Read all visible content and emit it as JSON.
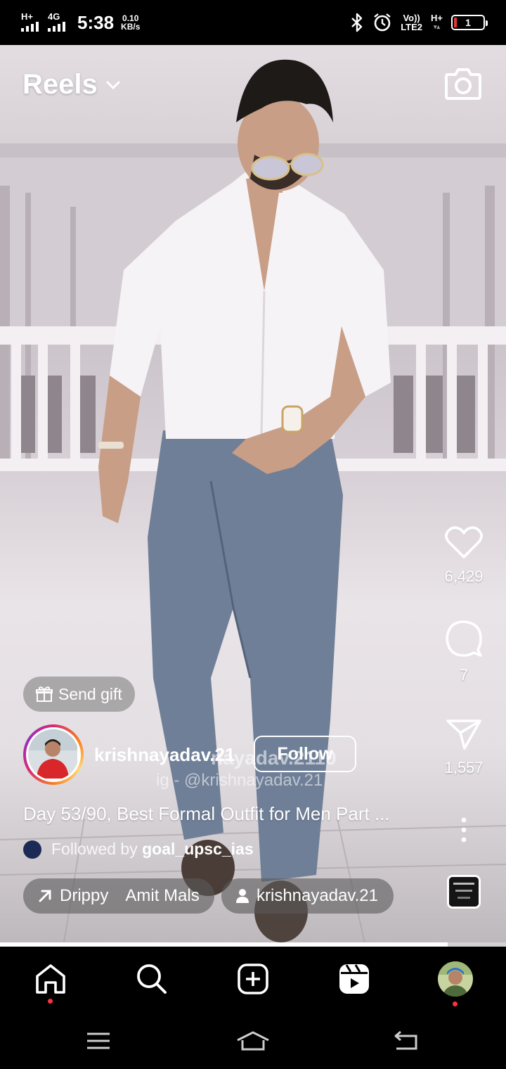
{
  "status_bar": {
    "sim1_tag": "H+",
    "sim2_tag": "4G",
    "time": "5:38",
    "net_speed_value": "0.10",
    "net_speed_unit": "KB/s",
    "volte_top": "Vo))",
    "volte_bottom": "LTE2",
    "sim2_right_tag": "H+",
    "battery_level": "1"
  },
  "header": {
    "title": "Reels",
    "camera_icon": "camera-icon",
    "dropdown_icon": "chevron-down-icon"
  },
  "actions": {
    "likes": "6,429",
    "comments": "7",
    "shares": "1,557"
  },
  "reel": {
    "send_gift_label": "Send gift",
    "username": "krishnayadav.21",
    "follow_label": "Follow",
    "watermark_line1": "nayadav.2110",
    "watermark_line2": "ig - @krishnayadav.21",
    "caption": "Day 53/90, Best Formal Outfit for Men Part ...",
    "followed_by_prefix": "Followed by",
    "followed_by_user": "goal_upsc_ias",
    "audio_label": "Drippy",
    "audio_artist": "Amit Mals",
    "tagged_user": "krishnayadav.21",
    "progress_fraction": 0.885
  },
  "bottom_nav": {
    "items": [
      "home-icon",
      "search-icon",
      "create-icon",
      "reels-icon",
      "profile-avatar"
    ]
  },
  "system_nav": {
    "items": [
      "menu-icon",
      "home-icon",
      "back-icon"
    ]
  },
  "colors": {
    "notification_dot": "#ff3040",
    "background": "#000000"
  }
}
